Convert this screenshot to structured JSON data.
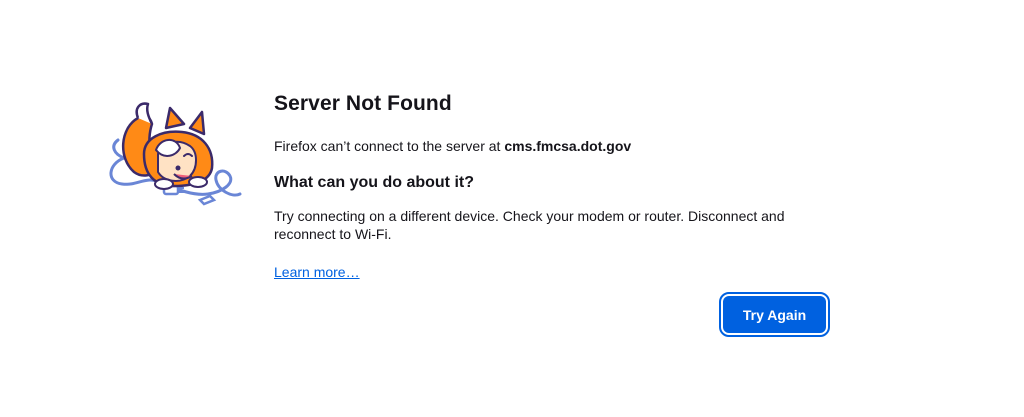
{
  "error": {
    "title": "Server Not Found",
    "description_prefix": "Firefox can’t connect to the server at ",
    "host": "cms.fmcsa.dot.gov",
    "subheading": "What can you do about it?",
    "advice": "Try connecting on a different device. Check your modem or router. Disconnect and reconnect to Wi-Fi.",
    "learn_more": "Learn more…",
    "try_again": "Try Again"
  },
  "illustration": {
    "icon": "fox-unplugged-cable-illustration"
  },
  "colors": {
    "accent": "#0061e0",
    "fox_orange": "#ff8a16",
    "cable_blue": "#6a86d6",
    "text": "#15141a"
  }
}
